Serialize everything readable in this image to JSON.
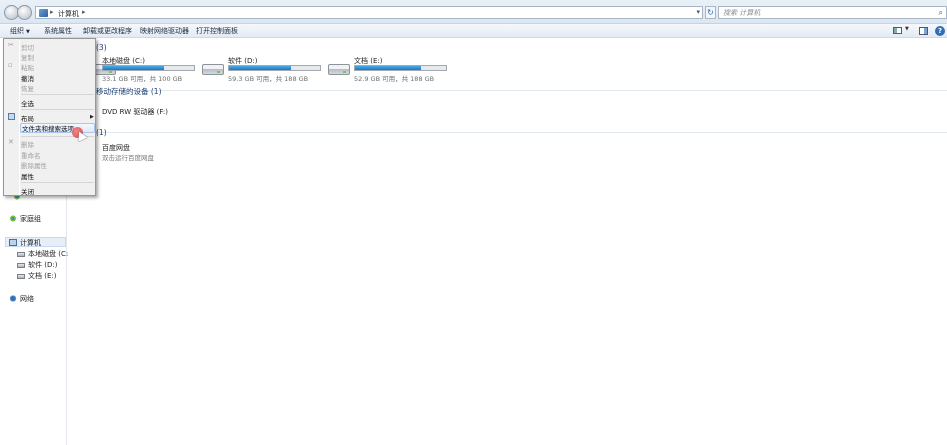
{
  "address": {
    "breadcrumb": "计算机",
    "search_placeholder": "搜索 计算机"
  },
  "toolbar": {
    "organize": "组织",
    "system_properties": "系统属性",
    "uninstall": "卸载或更改程序",
    "map_drive": "映射网络驱动器",
    "control_panel": "打开控制面板"
  },
  "nav": {
    "homegroup": "家庭组",
    "computer": "计算机",
    "drive_c": "本地磁盘 (C:)",
    "drive_d": "软件 (D:)",
    "drive_e": "文档 (E:)",
    "network": "网络"
  },
  "content": {
    "hard_disks_count": "(3)",
    "removable_header": "移动存储的设备 (1)",
    "other_count": "(1)",
    "drives": [
      {
        "name": "本地磁盘 (C:)",
        "size": "33.1 GB 可用，共 100 GB",
        "used_fraction": 0.67
      },
      {
        "name": "软件 (D:)",
        "size": "59.3 GB 可用，共 188 GB",
        "used_fraction": 0.68
      },
      {
        "name": "文档 (E:)",
        "size": "52.9 GB 可用，共 188 GB",
        "used_fraction": 0.72
      }
    ],
    "dvd": "DVD RW 驱动器 (F:)",
    "baidu_title": "百度网盘",
    "baidu_sub": "双击运行百度网盘"
  },
  "menu": {
    "cut": "剪切",
    "copy": "复制",
    "paste": "粘贴",
    "undo": "撤消",
    "redo": "恢复",
    "select_all": "全选",
    "layout": "布局",
    "folder_options": "文件夹和搜索选项",
    "delete": "删除",
    "rename": "重命名",
    "remove_properties": "删除属性",
    "properties": "属性",
    "close": "关闭"
  }
}
